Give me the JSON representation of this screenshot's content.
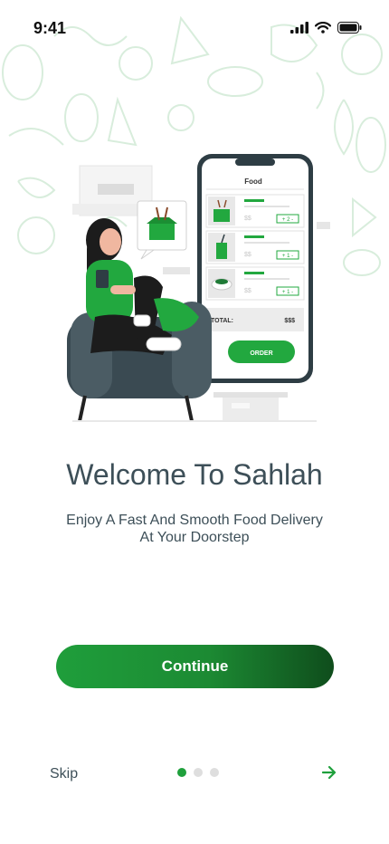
{
  "status_bar": {
    "time": "9:41"
  },
  "illustration": {
    "phone_header": "Food",
    "total_label": "TOTAL:",
    "total_value": "$$$",
    "order_label": "ORDER",
    "items": [
      {
        "price": "$$",
        "qty": "+ 2 -"
      },
      {
        "price": "$$",
        "qty": "+ 1 -"
      },
      {
        "price": "$$",
        "qty": "+ 1 -"
      }
    ]
  },
  "onboarding": {
    "title": "Welcome To Sahlah",
    "subtitle_line1": "Enjoy A Fast And Smooth Food Delivery",
    "subtitle_line2": "At Your Doorstep",
    "continue_label": "Continue",
    "skip_label": "Skip",
    "page_count": 3,
    "active_page": 1
  },
  "colors": {
    "accent": "#1fa03c",
    "text": "#3d4f58",
    "dot_inactive": "#dedede"
  }
}
